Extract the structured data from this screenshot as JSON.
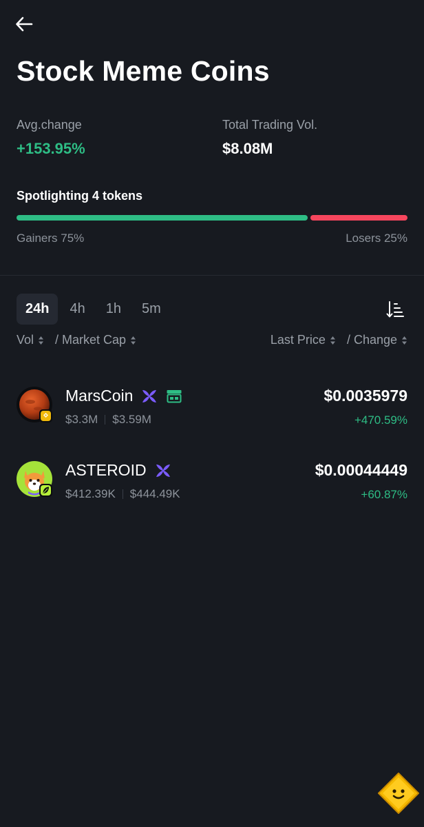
{
  "header": {
    "back_icon": "arrow-left-icon",
    "title": "Stock Meme Coins"
  },
  "stats": {
    "avg_change_label": "Avg.change",
    "avg_change_value": "+153.95%",
    "total_volume_label": "Total Trading Vol.",
    "total_volume_value": "$8.08M"
  },
  "spotlight": {
    "label": "Spotlighting 4 tokens",
    "gainers_label": "Gainers 75%",
    "losers_label": "Losers 25%",
    "gainers_pct": 75,
    "losers_pct": 25
  },
  "timeframes": {
    "tabs": [
      "24h",
      "4h",
      "1h",
      "5m"
    ],
    "selected": "24h"
  },
  "columns": {
    "vol": "Vol",
    "market_cap": "/ Market Cap",
    "last_price": "Last Price",
    "change": "/ Change"
  },
  "tokens": [
    {
      "name": "MarsCoin",
      "volume": "$3.3M",
      "market_cap": "$3.59M",
      "price": "$0.0035979",
      "change": "+470.59%",
      "icons": [
        "mars-planet-icon",
        "bnb-chain-badge-icon",
        "x-network-icon",
        "ticket-icon"
      ]
    },
    {
      "name": "ASTEROID",
      "volume": "$412.39K",
      "market_cap": "$444.49K",
      "price": "$0.00044449",
      "change": "+60.87%",
      "icons": [
        "shiba-dog-icon",
        "leaf-badge-icon",
        "x-network-icon"
      ]
    }
  ],
  "colors": {
    "background": "#171a20",
    "gain": "#2ebd85",
    "loss": "#f6465d",
    "muted": "#9aa0a8",
    "accent_purple": "#7b5cff"
  },
  "floating": {
    "mascot_icon": "mascot-smiley-icon"
  }
}
